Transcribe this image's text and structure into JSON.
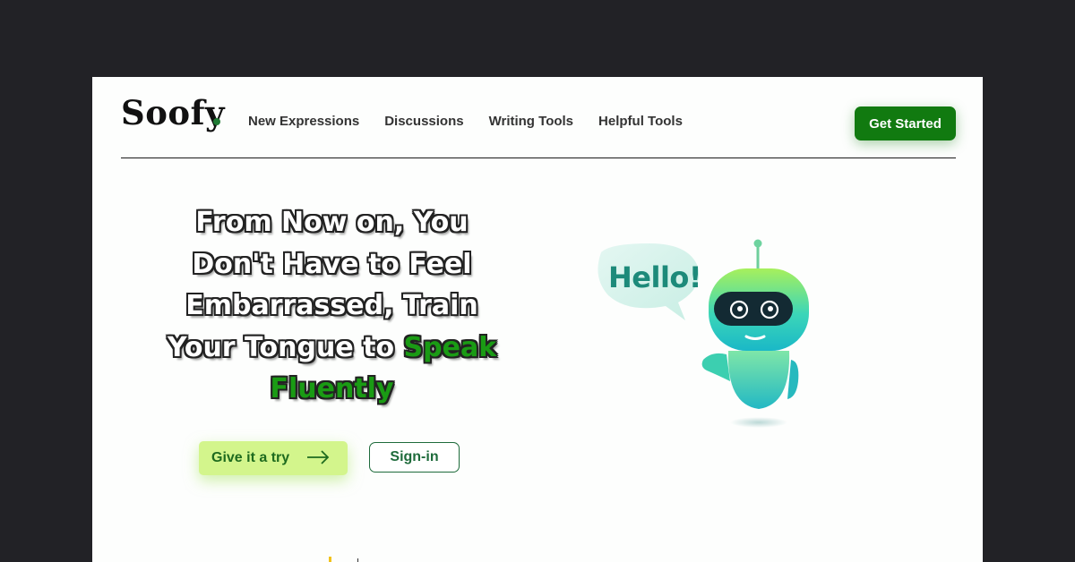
{
  "brand": {
    "name": "Soofy",
    "dot_color": "#1f7a34"
  },
  "nav": {
    "items": [
      {
        "label": "New Expressions"
      },
      {
        "label": "Discussions"
      },
      {
        "label": "Writing Tools"
      },
      {
        "label": "Helpful Tools"
      }
    ]
  },
  "header": {
    "cta_label": "Get Started",
    "cta_color": "#117a10"
  },
  "hero": {
    "title_line1": "From Now on, You",
    "title_line2": "Don't Have to Feel",
    "title_line3": "Embarrassed, Train",
    "title_line4_plain": "Your Tongue to",
    "title_line4_highlight": "Speak",
    "title_line5_highlight": "Fluently",
    "highlight_color": "#1a9b14",
    "primary_button": "Give it a try",
    "secondary_button": "Sign-in"
  },
  "illustration": {
    "bubble_text": "Hello!",
    "icon": "robot-mascot"
  },
  "colors": {
    "page_bg": "#fdfefd",
    "backdrop": "#222226",
    "try_button_bg": "#d3f58c"
  }
}
